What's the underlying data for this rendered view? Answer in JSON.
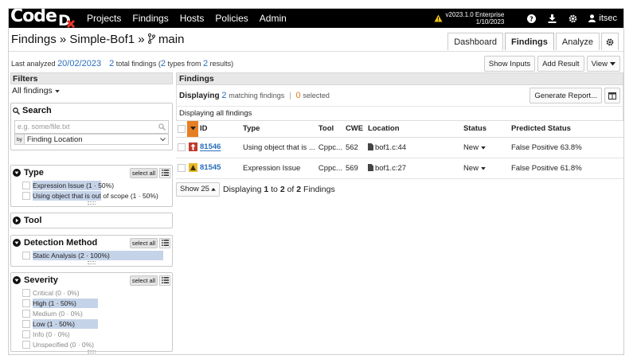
{
  "brand": {
    "logo_text": "Code",
    "logo_accent": "#e8342a"
  },
  "nav": {
    "items": [
      "Projects",
      "Findings",
      "Hosts",
      "Policies",
      "Admin"
    ],
    "version_line1": "v2023.1.0 Enterprise",
    "version_line2": "1/10/2023",
    "user": "itsec"
  },
  "header": {
    "title": "Findings » Simple-Bof1 » ",
    "branch": "main",
    "tabs": [
      "Dashboard",
      "Findings",
      "Analyze"
    ],
    "active_tab": "Findings"
  },
  "info": {
    "last_analyzed_label": "Last analyzed",
    "last_analyzed_date": "20/02/2023",
    "total_count": "2",
    "total_label": "total findings (",
    "types_count": "2",
    "types_label": "types from",
    "results_count": "2",
    "results_label": "results)",
    "buttons": [
      "Show Inputs",
      "Add Result",
      "View"
    ]
  },
  "filters": {
    "header": "Filters",
    "preset": "All findings",
    "search": {
      "title": "Search",
      "placeholder": "e.g. some/file.txt",
      "by_label": "by",
      "by_value": "Finding Location"
    },
    "select_all": "select all",
    "type": {
      "title": "Type",
      "options": [
        {
          "label": "Expression Issue (1 · 50%)",
          "pct": 50
        },
        {
          "label": "Using object that is out of scope (1 · 50%)",
          "pct": 50
        }
      ]
    },
    "tool": {
      "title": "Tool"
    },
    "detection": {
      "title": "Detection Method",
      "options": [
        {
          "label": "Static Analysis (2 · 100%)",
          "pct": 100
        }
      ]
    },
    "severity": {
      "title": "Severity",
      "options": [
        {
          "label": "Critical (0 · 0%)",
          "pct": 0
        },
        {
          "label": "High (1 · 50%)",
          "pct": 50
        },
        {
          "label": "Medium (0 · 0%)",
          "pct": 0
        },
        {
          "label": "Low (1 · 50%)",
          "pct": 50
        },
        {
          "label": "Info (0 · 0%)",
          "pct": 0
        },
        {
          "label": "Unspecified (0 · 0%)",
          "pct": 0
        }
      ]
    }
  },
  "findings": {
    "header": "Findings",
    "displaying_label": "Displaying",
    "matching_count": "2",
    "matching_label": "matching findings",
    "selected_count": "0",
    "selected_label": "selected",
    "generate_report": "Generate Report...",
    "all_label": "Displaying all findings",
    "columns": [
      "ID",
      "Type",
      "Tool",
      "CWE",
      "Location",
      "Status",
      "Predicted Status"
    ],
    "rows": [
      {
        "id": "81546",
        "severity": "High",
        "sev_color": "#c0392b",
        "type": "Using object that is ...",
        "tool": "Cppc...",
        "cwe": "562",
        "location": "bof1.c:44",
        "status": "New",
        "predicted": "False Positive 63.8%"
      },
      {
        "id": "81545",
        "severity": "Low",
        "sev_color": "#e8b923",
        "type": "Expression Issue",
        "tool": "Cppc...",
        "cwe": "569",
        "location": "bof1.c:27",
        "status": "New",
        "predicted": "False Positive 61.8%"
      }
    ],
    "pager": {
      "show": "Show 25",
      "text_a": "Displaying",
      "from": "1",
      "to_label": "to",
      "to": "2",
      "of_label": "of",
      "total": "2",
      "suffix": "Findings"
    }
  }
}
